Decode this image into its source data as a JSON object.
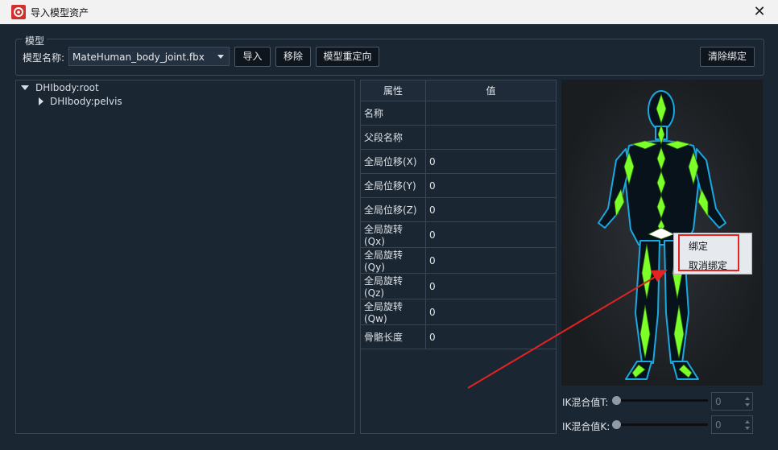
{
  "window": {
    "title": "导入模型资产",
    "logo_icon": "app-logo-icon",
    "close_icon": "close-icon",
    "close_glyph": "✕"
  },
  "model_group": {
    "title": "模型",
    "model_name_label": "模型名称:",
    "model_name_value": "MateHuman_body_joint.fbx",
    "buttons": {
      "import": "导入",
      "remove": "移除",
      "retarget": "模型重定向",
      "clear_binding": "清除绑定"
    }
  },
  "tree": {
    "items": [
      {
        "label": "DHIbody:root",
        "expanded": true
      },
      {
        "label": "DHIbody:pelvis",
        "expanded": false
      }
    ]
  },
  "properties": {
    "headers": {
      "attribute": "属性",
      "value": "值"
    },
    "rows": [
      {
        "name": "名称",
        "value": ""
      },
      {
        "name": "父段名称",
        "value": ""
      },
      {
        "name": "全局位移(X)",
        "value": "0"
      },
      {
        "name": "全局位移(Y)",
        "value": "0"
      },
      {
        "name": "全局位移(Z)",
        "value": "0"
      },
      {
        "name": "全局旋转(Qx)",
        "value": "0"
      },
      {
        "name": "全局旋转(Qy)",
        "value": "0"
      },
      {
        "name": "全局旋转(Qz)",
        "value": "0"
      },
      {
        "name": "全局旋转(Qw)",
        "value": "0"
      },
      {
        "name": "骨骼长度",
        "value": "0"
      }
    ]
  },
  "context_menu": {
    "bind": "绑定",
    "unbind": "取消绑定"
  },
  "ik": {
    "t_label": "IK混合值T:",
    "t_value": "0",
    "t_level": 0,
    "k_label": "IK混合值K:",
    "k_value": "0",
    "k_level": 0
  },
  "colors": {
    "accent_red": "#e32222",
    "bone_green": "#7dff2a",
    "body_outline": "#1aa8e0"
  }
}
